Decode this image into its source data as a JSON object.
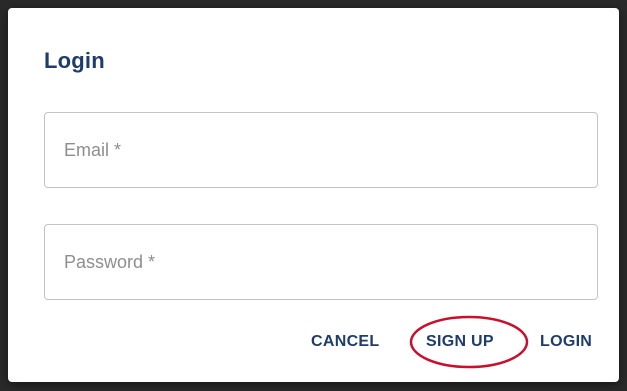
{
  "dialog": {
    "title": "Login",
    "fields": {
      "email": {
        "label": "Email *",
        "value": ""
      },
      "password": {
        "label": "Password *",
        "value": ""
      }
    },
    "actions": {
      "cancel_label": "CANCEL",
      "signup_label": "SIGN UP",
      "login_label": "LOGIN"
    }
  },
  "colors": {
    "title": "#1f3c6e",
    "button_text": "#1f3c6e",
    "field_border": "#c4c4c4",
    "label_text": "#8e8e8e",
    "highlight_oval": "#c8102e"
  }
}
